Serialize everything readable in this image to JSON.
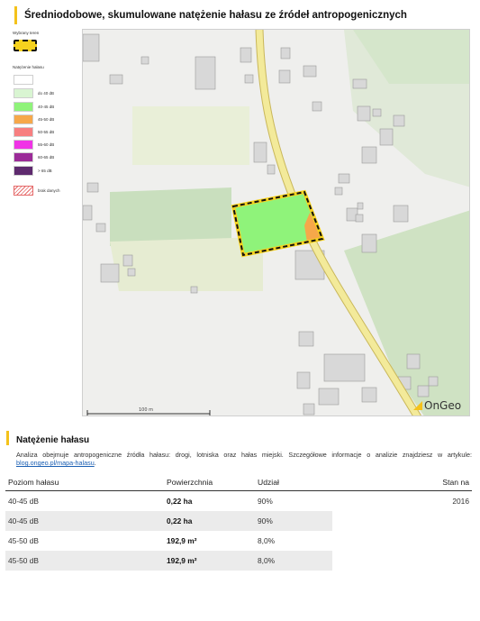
{
  "page": {
    "title": "Średniodobowe, skumulowane natężenie hałasu ze źródeł antropogenicznych"
  },
  "legend": {
    "selected_area_label": "Wybrany teren",
    "noise_heading": "Natężenie hałasu",
    "items": [
      {
        "label": "",
        "color": "#ffffff"
      },
      {
        "label": "do 40 dB",
        "color": "#d9f5d2"
      },
      {
        "label": "40-45 dB",
        "color": "#8ff37a"
      },
      {
        "label": "45-50 dB",
        "color": "#f6a84a"
      },
      {
        "label": "50-55 dB",
        "color": "#f77f80"
      },
      {
        "label": "55-60 dB",
        "color": "#f033e6"
      },
      {
        "label": "60-65 dB",
        "color": "#9b2b98"
      },
      {
        "label": "> 65 dB",
        "color": "#5e2a6e"
      },
      {
        "label": "brak danych",
        "color": "hatch-red"
      }
    ]
  },
  "map": {
    "scale_label": "100 m",
    "logo_text": "OnGeo",
    "colors": {
      "road": "#f3ea9a",
      "selected_outline": "#111111",
      "selected_highlight": "#f6d21e",
      "zone_green": "#8ff37a",
      "zone_orange": "#f6a84a",
      "forest": "#cfe2c3",
      "field": "#e8eed5"
    }
  },
  "section": {
    "heading": "Natężenie hałasu",
    "description": "Analiza obejmuje antropogeniczne źródła hałasu: drogi, lotniska oraz hałas miejski. Szczegółowe informacje o analizie znajdziesz w artykule:",
    "link_text": "blog.ongeo.pl/mapa-halasu",
    "link_suffix": "."
  },
  "table": {
    "headers": [
      "Poziom hałasu",
      "Powierzchnia",
      "Udział",
      "Stan na"
    ],
    "rows": [
      {
        "level": "40-45 dB",
        "area": "0,22 ha",
        "share": "90%",
        "date": "2016"
      },
      {
        "level": "40-45 dB",
        "area": "0,22 ha",
        "share": "90%",
        "date": ""
      },
      {
        "level": "45-50 dB",
        "area": "192,9 m²",
        "share": "8,0%",
        "date": ""
      },
      {
        "level": "45-50 dB",
        "area": "192,9 m²",
        "share": "8,0%",
        "date": ""
      }
    ]
  }
}
